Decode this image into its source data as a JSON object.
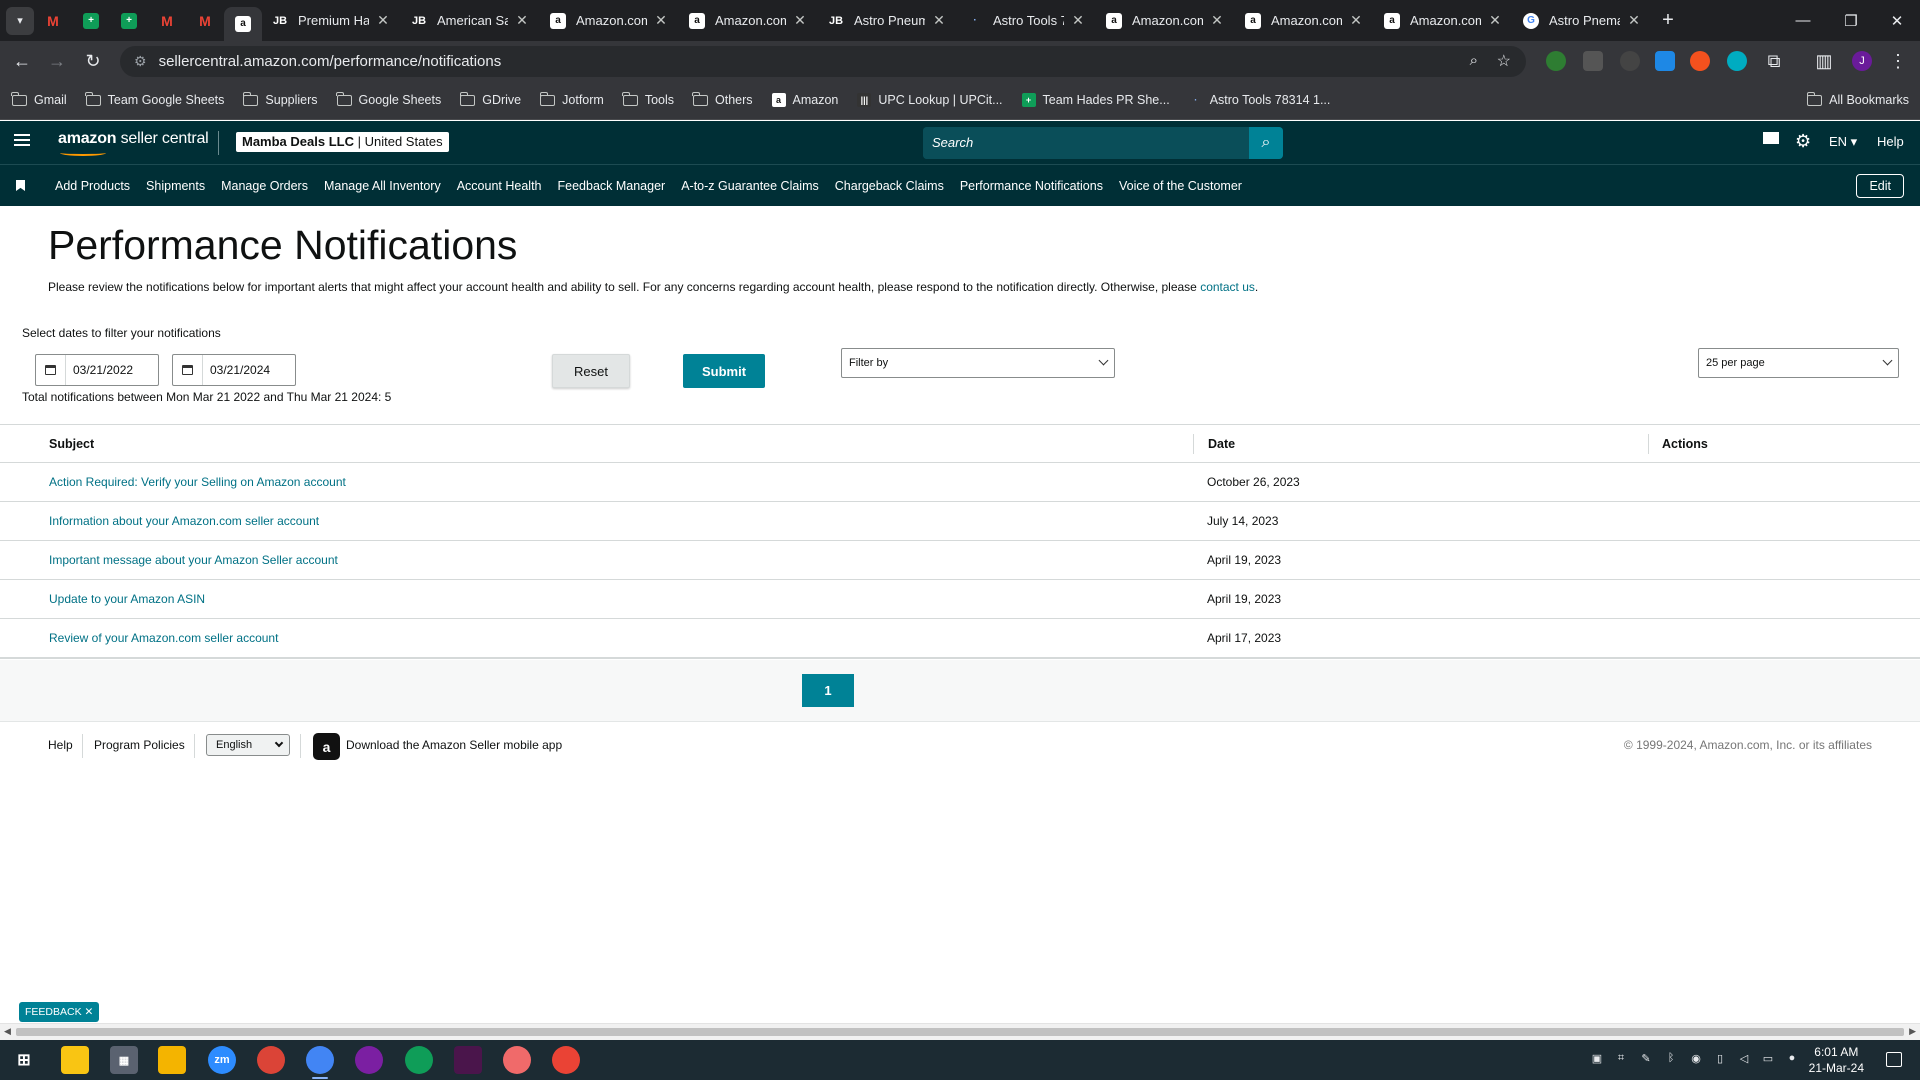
{
  "browser": {
    "tabs": [
      {
        "kind": "pinned",
        "icon": "gmail-icon",
        "color": "#ea4335",
        "letter": "M"
      },
      {
        "kind": "pinned",
        "icon": "sheets-icon",
        "color": "#0f9d58",
        "letter": "+"
      },
      {
        "kind": "pinned",
        "icon": "sheets-icon",
        "color": "#0f9d58",
        "letter": "+"
      },
      {
        "kind": "pinned",
        "icon": "gmail-icon",
        "color": "#ea4335",
        "letter": "M"
      },
      {
        "kind": "pinned",
        "icon": "gmail-icon",
        "color": "#ea4335",
        "letter": "M"
      },
      {
        "kind": "pinned",
        "icon": "amazon-icon",
        "color": "#ffffff",
        "letter": "a",
        "active": true
      },
      {
        "title": "Premium Ha",
        "icon": "jetbrains-icon",
        "letter": "JB"
      },
      {
        "title": "American Sa",
        "icon": "jetbrains-icon",
        "letter": "JB"
      },
      {
        "title": "Amazon.com",
        "icon": "amazon-icon",
        "letter": "a"
      },
      {
        "title": "Amazon.com",
        "icon": "amazon-icon",
        "letter": "a"
      },
      {
        "title": "Astro Pneum",
        "icon": "jetbrains-icon",
        "letter": "JB"
      },
      {
        "title": "Astro Tools 7",
        "icon": "dot-icon",
        "letter": "·"
      },
      {
        "title": "Amazon.com",
        "icon": "amazon-icon",
        "letter": "a"
      },
      {
        "title": "Amazon.com",
        "icon": "amazon-icon",
        "letter": "a"
      },
      {
        "title": "Amazon.com",
        "icon": "amazon-icon",
        "letter": "a"
      },
      {
        "title": "Astro Pnema",
        "icon": "google-icon",
        "letter": "G"
      }
    ],
    "url": "sellercentral.amazon.com/performance/notifications",
    "bookmarks": [
      {
        "label": "Gmail",
        "icon": "folder-icon"
      },
      {
        "label": "Team Google Sheets",
        "icon": "folder-icon"
      },
      {
        "label": "Suppliers",
        "icon": "folder-icon"
      },
      {
        "label": "Google Sheets",
        "icon": "folder-icon"
      },
      {
        "label": "GDrive",
        "icon": "folder-icon"
      },
      {
        "label": "Jotform",
        "icon": "folder-icon"
      },
      {
        "label": "Tools",
        "icon": "folder-icon"
      },
      {
        "label": "Others",
        "icon": "folder-icon"
      },
      {
        "label": "Amazon",
        "icon": "amazon-icon"
      },
      {
        "label": "UPC Lookup | UPCit...",
        "icon": "barcode-icon"
      },
      {
        "label": "Team Hades PR She...",
        "icon": "sheets-icon"
      },
      {
        "label": "Astro Tools 78314 1...",
        "icon": "dot-icon"
      }
    ],
    "all_bookmarks": "All Bookmarks"
  },
  "header": {
    "logo_bold": "amazon",
    "logo_rest": " seller central",
    "account_name": "Mamba Deals LLC",
    "account_region": "United States",
    "search_placeholder": "Search",
    "lang": "EN",
    "help": "Help"
  },
  "nav": {
    "items": [
      "Add Products",
      "Shipments",
      "Manage Orders",
      "Manage All Inventory",
      "Account Health",
      "Feedback Manager",
      "A-to-z Guarantee Claims",
      "Chargeback Claims",
      "Performance Notifications",
      "Voice of the Customer"
    ],
    "edit": "Edit"
  },
  "page": {
    "title": "Performance Notifications",
    "description": "Please review the notifications below for important alerts that might affect your account health and ability to sell. For any concerns regarding account health, please respond to the notification directly. Otherwise, please ",
    "contact_link": "contact us",
    "description_end": ".",
    "select_dates_label": "Select dates to filter your notifications",
    "date_from": "03/21/2022",
    "date_to": "03/21/2024",
    "total_text": "Total notifications between Mon Mar 21 2022 and Thu Mar 21 2024: 5",
    "reset": "Reset",
    "submit": "Submit",
    "filter_placeholder": "Filter by",
    "per_page": "25 per page"
  },
  "table": {
    "columns": [
      "Subject",
      "Date",
      "Actions"
    ],
    "rows": [
      {
        "subject": "Action Required: Verify your Selling on Amazon account",
        "date": "October 26, 2023"
      },
      {
        "subject": "Information about your Amazon.com seller account",
        "date": "July 14, 2023"
      },
      {
        "subject": "Important message about your Amazon Seller account",
        "date": "April 19, 2023"
      },
      {
        "subject": "Update to your Amazon ASIN",
        "date": "April 19, 2023"
      },
      {
        "subject": "Review of your Amazon.com seller account",
        "date": "April 17, 2023"
      }
    ]
  },
  "pagination": {
    "current": "1"
  },
  "footer": {
    "help": "Help",
    "program_policies": "Program Policies",
    "language": "English",
    "download_app": "Download the Amazon Seller mobile app",
    "copyright": "© 1999-2024, Amazon.com, Inc. or its affiliates"
  },
  "feedback": "FEEDBACK",
  "taskbar": {
    "time": "6:01 AM",
    "date": "21-Mar-24"
  },
  "colors": {
    "teal": "#008296",
    "header": "#002f36",
    "link": "#007185"
  }
}
